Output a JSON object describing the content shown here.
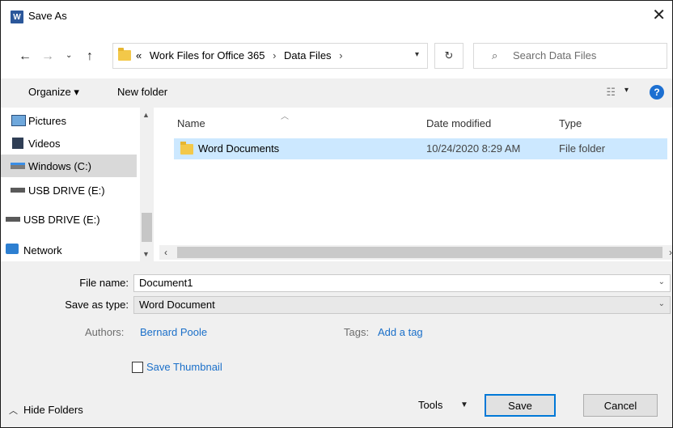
{
  "window": {
    "title": "Save As",
    "app_icon": "W"
  },
  "address": {
    "overflow": "«",
    "crumbs": [
      "Work Files for Office 365",
      "Data Files"
    ],
    "separator": "›"
  },
  "search": {
    "placeholder": "Search Data Files"
  },
  "toolbar": {
    "organize": "Organize ▾",
    "new_folder": "New folder"
  },
  "nav": {
    "items": [
      {
        "label": "Pictures"
      },
      {
        "label": "Videos"
      },
      {
        "label": "Windows (C:)",
        "selected": true
      },
      {
        "label": "USB DRIVE (E:)"
      },
      {
        "label": "USB DRIVE (E:)"
      },
      {
        "label": "Network"
      }
    ]
  },
  "files": {
    "columns": {
      "name": "Name",
      "date": "Date modified",
      "type": "Type"
    },
    "rows": [
      {
        "name": "Word Documents",
        "date": "10/24/2020 8:29 AM",
        "type": "File folder"
      }
    ]
  },
  "form": {
    "file_name_label": "File name:",
    "file_name_value": "Document1",
    "save_type_label": "Save as type:",
    "save_type_value": "Word Document",
    "authors_label": "Authors:",
    "authors_value": "Bernard Poole",
    "tags_label": "Tags:",
    "tags_value": "Add a tag",
    "thumbnail_label": "Save Thumbnail"
  },
  "footer": {
    "hide_folders": "Hide Folders",
    "tools": "Tools",
    "save": "Save",
    "cancel": "Cancel"
  },
  "colors": {
    "accent": "#0078d7",
    "selection": "#cce8ff",
    "link": "#1a6fc9",
    "panel": "#f0f0f0"
  }
}
